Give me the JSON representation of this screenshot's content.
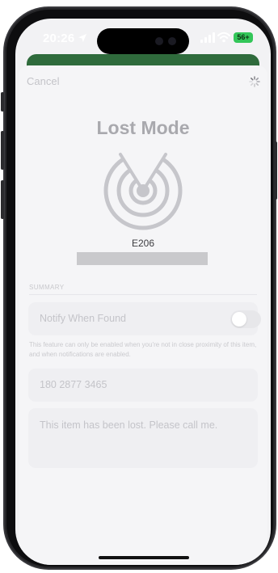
{
  "status_bar": {
    "time": "20:26",
    "battery": "56+",
    "icons": [
      "location-arrow-icon",
      "signal-icon",
      "wifi-icon",
      "battery-icon"
    ]
  },
  "sheet": {
    "cancel_label": "Cancel",
    "title": "Lost Mode",
    "device_name": "E206",
    "icons": [
      "radar-icon",
      "spinner-icon"
    ]
  },
  "summary": {
    "header": "SUMMARY",
    "notify_label": "Notify When Found",
    "notify_enabled": false,
    "footnote": "This feature can only be enabled when you're not in close proximity of this item, and when notifications are enabled.",
    "phone_number": "180 2877 3465",
    "message": "This item has been lost. Please call me."
  },
  "colors": {
    "battery_green": "#33c659",
    "disabled_text": "#c4c4c9",
    "title_gray": "#a9a9ae"
  }
}
